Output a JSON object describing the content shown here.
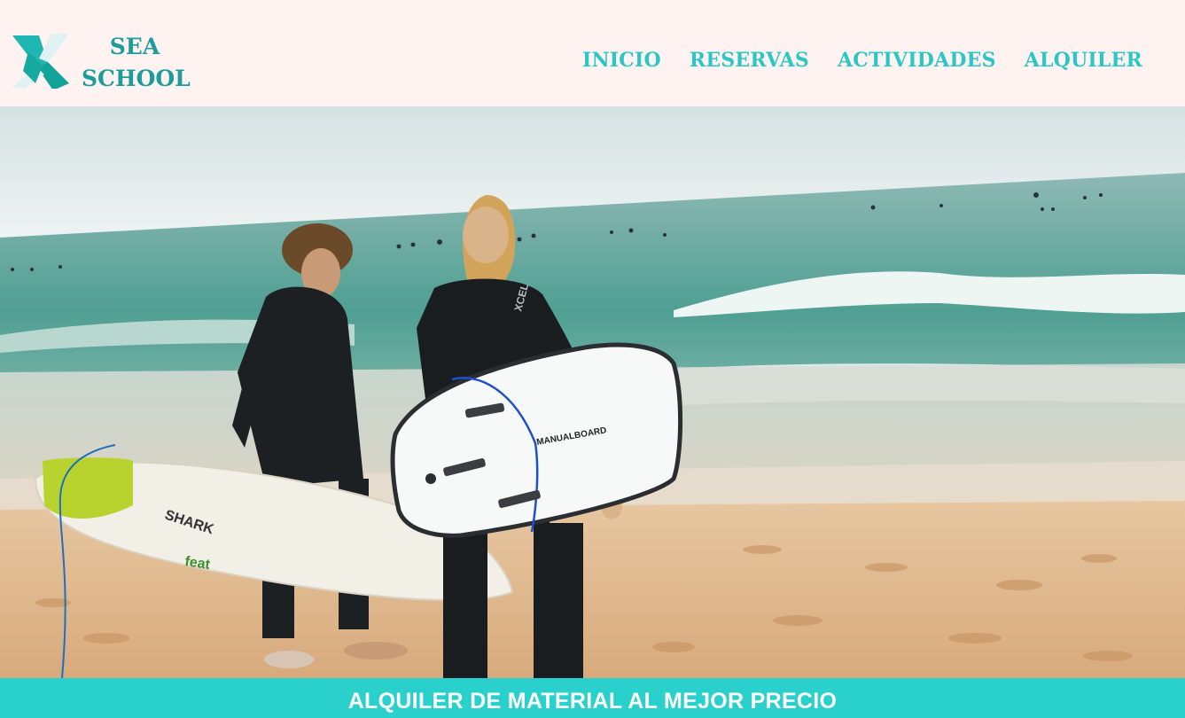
{
  "brand": {
    "line1": "SEA",
    "line2": "SCHOOL",
    "color": "#1e9c9a",
    "logo_icon": "stylized-x-icon"
  },
  "nav": {
    "items": [
      "INICIO",
      "RESERVAS",
      "ACTIVIDADES",
      "ALQUILER"
    ],
    "color": "#2cc7c4"
  },
  "hero": {
    "image": "hero-photo-surfers-on-beach"
  },
  "surfboard_prints": {
    "left_board_brand": "SHARK",
    "left_board_tag": "feat",
    "right_board_text": "MANUALBOARD",
    "wetsuit_text": "XCEL"
  },
  "banner": {
    "text": "ALQUILER DE MATERIAL AL MEJOR PRECIO",
    "background": "#29d0cc"
  },
  "colors": {
    "header_bg": "#fff3f2",
    "accent": "#2cc7c4"
  }
}
